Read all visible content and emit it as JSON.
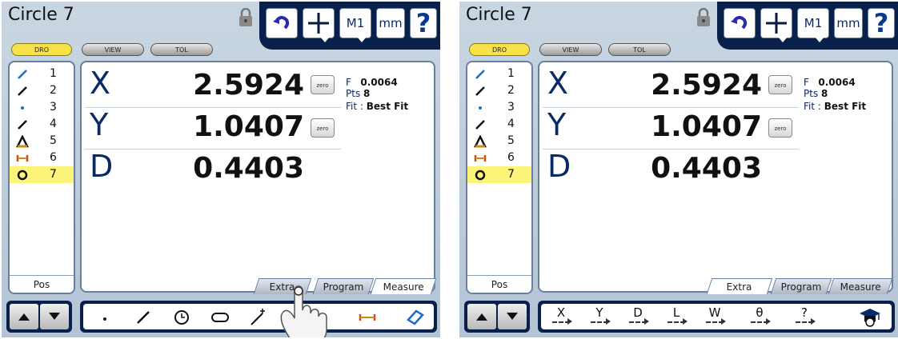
{
  "panels": [
    {
      "title": "Circle 7",
      "toolbar": {
        "m1": "M1",
        "unit": "mm",
        "help": "?"
      },
      "mode_tabs": [
        "DRO",
        "VIEW",
        "TOL"
      ],
      "features": [
        {
          "num": "1",
          "icon": "line-icon"
        },
        {
          "num": "2",
          "icon": "line-icon"
        },
        {
          "num": "3",
          "icon": "point-icon"
        },
        {
          "num": "4",
          "icon": "line-icon"
        },
        {
          "num": "5",
          "icon": "angle-icon"
        },
        {
          "num": "6",
          "icon": "distance-icon"
        },
        {
          "num": "7",
          "icon": "circle-icon",
          "selected": true
        }
      ],
      "pos_label": "Pos",
      "readout": {
        "x_label": "X",
        "x_value": "2.5924",
        "y_label": "Y",
        "y_value": "1.0407",
        "d_label": "D",
        "d_value": "0.4403",
        "zero_label": "zero",
        "f_label": "F",
        "f_value": "0.0064",
        "pts_label": "Pts",
        "pts_value": "8",
        "fit_label": "Fit :",
        "fit_value": "Best Fit"
      },
      "tabs": [
        "Extra",
        "Program",
        "Measure"
      ],
      "active_tab": "Measure",
      "measure_tools": [
        "point-icon",
        "line-icon",
        "circle-icon",
        "slot-icon",
        "wand-icon",
        "distance-icon",
        "skew-icon"
      ]
    },
    {
      "title": "Circle 7",
      "toolbar": {
        "m1": "M1",
        "unit": "mm",
        "help": "?"
      },
      "mode_tabs": [
        "DRO",
        "VIEW",
        "TOL"
      ],
      "features": [
        {
          "num": "1",
          "icon": "line-icon"
        },
        {
          "num": "2",
          "icon": "line-icon"
        },
        {
          "num": "3",
          "icon": "point-icon"
        },
        {
          "num": "4",
          "icon": "line-icon"
        },
        {
          "num": "5",
          "icon": "angle-icon"
        },
        {
          "num": "6",
          "icon": "distance-icon"
        },
        {
          "num": "7",
          "icon": "circle-icon",
          "selected": true
        }
      ],
      "pos_label": "Pos",
      "readout": {
        "x_label": "X",
        "x_value": "2.5924",
        "y_label": "Y",
        "y_value": "1.0407",
        "d_label": "D",
        "d_value": "0.4403",
        "zero_label": "zero",
        "f_label": "F",
        "f_value": "0.0064",
        "pts_label": "Pts",
        "pts_value": "8",
        "fit_label": "Fit :",
        "fit_value": "Best Fit"
      },
      "tabs": [
        "Extra",
        "Program",
        "Measure"
      ],
      "active_tab": "Extra",
      "extra_buttons": [
        "X",
        "Y",
        "D",
        "L",
        "W",
        "θ",
        "?"
      ]
    }
  ]
}
